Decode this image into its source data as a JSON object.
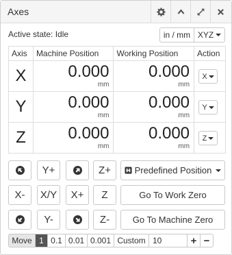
{
  "panel": {
    "title": "Axes"
  },
  "header_icons": [
    "gear-icon",
    "chevron-up-icon",
    "expand-icon",
    "close-icon"
  ],
  "active_state": "Active state: Idle",
  "units": {
    "label": "in / mm"
  },
  "axes_select": {
    "label": "XYZ"
  },
  "table": {
    "headers": [
      "Axis",
      "Machine Position",
      "Working Position",
      "Action"
    ],
    "rows": [
      {
        "axis": "X",
        "machine": "0.000",
        "machine_unit": "mm",
        "working": "0.000",
        "working_unit": "mm",
        "action": "X"
      },
      {
        "axis": "Y",
        "machine": "0.000",
        "machine_unit": "mm",
        "working": "0.000",
        "working_unit": "mm",
        "action": "Y"
      },
      {
        "axis": "Z",
        "machine": "0.000",
        "machine_unit": "mm",
        "working": "0.000",
        "working_unit": "mm",
        "action": "Z"
      }
    ]
  },
  "jog": {
    "y_plus": "Y+",
    "z_plus": "Z+",
    "x_minus": "X-",
    "xy": "X/Y",
    "x_plus": "X+",
    "z": "Z",
    "y_minus": "Y-",
    "z_minus": "Z-",
    "predefined": "Predefined Position",
    "go_work_zero": "Go To Work Zero",
    "go_machine_zero": "Go To Machine Zero"
  },
  "move": {
    "label": "Move",
    "steps": [
      "1",
      "0.1",
      "0.01",
      "0.001"
    ],
    "selected": "1",
    "custom_label": "Custom",
    "custom_value": "10",
    "plus": "+",
    "minus": "−"
  }
}
